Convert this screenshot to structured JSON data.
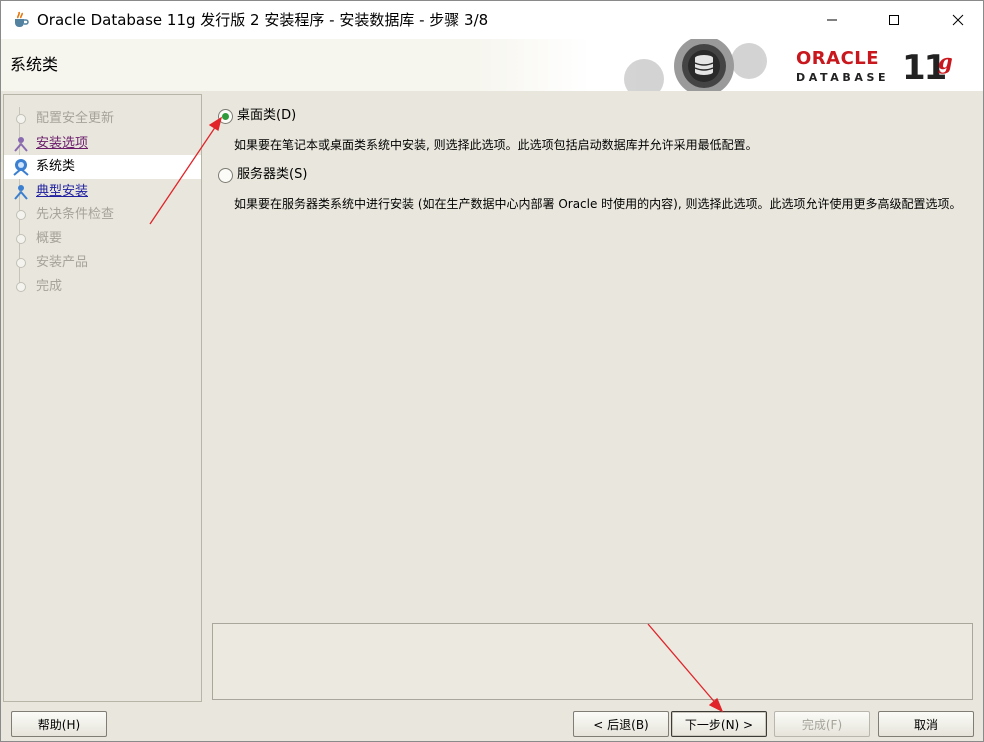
{
  "window": {
    "title": "Oracle Database 11g 发行版 2 安装程序 - 安装数据库 - 步骤 3/8",
    "controls": [
      "minimize-icon",
      "maximize-icon",
      "close-icon"
    ]
  },
  "banner": {
    "page_title": "系统类",
    "logo": {
      "brand": "ORACLE",
      "product": "DATABASE",
      "version": "11",
      "version_suffix": "g"
    }
  },
  "steps": {
    "items": [
      {
        "label": "配置安全更新",
        "state": "disabled"
      },
      {
        "label": "安装选项",
        "state": "visited"
      },
      {
        "label": "系统类",
        "state": "current"
      },
      {
        "label": "典型安装",
        "state": "link"
      },
      {
        "label": "先决条件检查",
        "state": "disabled"
      },
      {
        "label": "概要",
        "state": "disabled"
      },
      {
        "label": "安装产品",
        "state": "disabled"
      },
      {
        "label": "完成",
        "state": "disabled"
      }
    ]
  },
  "options": [
    {
      "label": "桌面类(D)",
      "checked": true,
      "description": "如果要在笔记本或桌面类系统中安装, 则选择此选项。此选项包括启动数据库并允许采用最低配置。"
    },
    {
      "label": "服务器类(S)",
      "checked": false,
      "description": "如果要在服务器类系统中进行安装 (如在生产数据中心内部署 Oracle 时使用的内容), 则选择此选项。此选项允许使用更多高级配置选项。"
    }
  ],
  "buttons": {
    "help": "帮助(H)",
    "back": "< 后退(B)",
    "next": "下一步(N) >",
    "finish": "完成(F)",
    "cancel": "取消"
  },
  "colors": {
    "oracle_red": "#c8171d",
    "panel_bg": "#e9e7dd",
    "radio_selected": "#2e9a3a",
    "annotation_arrow": "#e0242a"
  }
}
